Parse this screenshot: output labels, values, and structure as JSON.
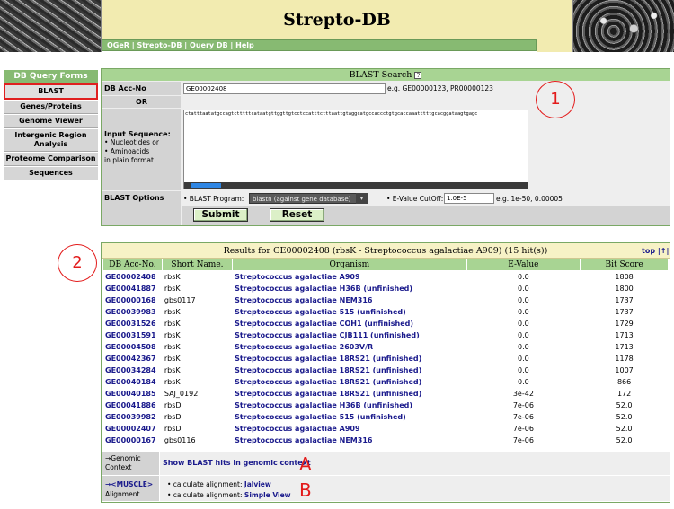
{
  "header": {
    "title": "Strepto-DB",
    "nav": [
      "OGeR",
      "Strepto-DB",
      "Query DB",
      "Help"
    ],
    "nav_sep": " | "
  },
  "menu": {
    "heading": "DB Query Forms",
    "items": [
      {
        "label": "BLAST",
        "active": true
      },
      {
        "label": "Genes/Proteins",
        "active": false
      },
      {
        "label": "Genome Viewer",
        "active": false
      },
      {
        "label": "Intergenic Region Analysis",
        "active": false
      },
      {
        "label": "Proteome Comparison",
        "active": false
      },
      {
        "label": "Sequences",
        "active": false
      }
    ]
  },
  "blast": {
    "title": "BLAST Search",
    "help_icon": "?",
    "acc_label": "DB Acc-No",
    "acc_value": "GE00002408",
    "acc_example": "e.g. GE00000123, PR00000123",
    "or_label": "OR",
    "seq_label": "Input Sequence:",
    "seq_hint_1": "• Nucleotides or",
    "seq_hint_2": "• Aminoacids",
    "seq_hint_3": "in plain format",
    "seq_value": "ctatttaatatgccagtctttttcataatgttggttgtcctccatttctttaattgtaggcatgccaccctgtgcaccaaatttttgcacggataagtgagc",
    "options_label": "BLAST Options",
    "program_label": "• BLAST Program:",
    "program_value": "blastn (against gene database)",
    "evalue_label": "• E-Value CutOff:",
    "evalue_value": "1.0E-5",
    "evalue_example": "e.g. 1e-50, 0.00005",
    "submit_label": "Submit",
    "reset_label": "Reset"
  },
  "annotations": {
    "c1": "1",
    "c2": "2",
    "a": "A",
    "b": "B"
  },
  "results": {
    "title": "Results for GE00002408 (rbsK - Streptococcus agalactiae A909) (15 hit(s))",
    "top_link": "top |↑|",
    "columns": [
      "DB Acc-No.",
      "Short Name.",
      "Organism",
      "E-Value",
      "Bit Score"
    ],
    "rows": [
      [
        "GE00002408",
        "rbsK",
        "Streptococcus agalactiae A909",
        "0.0",
        "1808"
      ],
      [
        "GE00041887",
        "rbsK",
        "Streptococcus agalactiae H36B (unfinished)",
        "0.0",
        "1800"
      ],
      [
        "GE00000168",
        "gbs0117",
        "Streptococcus agalactiae NEM316",
        "0.0",
        "1737"
      ],
      [
        "GE00039983",
        "rbsK",
        "Streptococcus agalactiae 515 (unfinished)",
        "0.0",
        "1737"
      ],
      [
        "GE00031526",
        "rbsK",
        "Streptococcus agalactiae COH1 (unfinished)",
        "0.0",
        "1729"
      ],
      [
        "GE00031591",
        "rbsK",
        "Streptococcus agalactiae CJB111 (unfinished)",
        "0.0",
        "1713"
      ],
      [
        "GE00004508",
        "rbsK",
        "Streptococcus agalactiae 2603V/R",
        "0.0",
        "1713"
      ],
      [
        "GE00042367",
        "rbsK",
        "Streptococcus agalactiae 18RS21 (unfinished)",
        "0.0",
        "1178"
      ],
      [
        "GE00034284",
        "rbsK",
        "Streptococcus agalactiae 18RS21 (unfinished)",
        "0.0",
        "1007"
      ],
      [
        "GE00040184",
        "rbsK",
        "Streptococcus agalactiae 18RS21 (unfinished)",
        "0.0",
        "866"
      ],
      [
        "GE00040185",
        "SAJ_0192",
        "Streptococcus agalactiae 18RS21 (unfinished)",
        "3e-42",
        "172"
      ],
      [
        "GE00041886",
        "rbsD",
        "Streptococcus agalactiae H36B (unfinished)",
        "7e-06",
        "52.0"
      ],
      [
        "GE00039982",
        "rbsD",
        "Streptococcus agalactiae 515 (unfinished)",
        "7e-06",
        "52.0"
      ],
      [
        "GE00002407",
        "rbsD",
        "Streptococcus agalactiae A909",
        "7e-06",
        "52.0"
      ],
      [
        "GE00000167",
        "gbs0116",
        "Streptococcus agalactiae NEM316",
        "7e-06",
        "52.0"
      ]
    ],
    "context_label_1": "→Genomic",
    "context_label_2": "Context",
    "context_link": "Show BLAST hits in genomic context",
    "align_label_link": "→<MUSCLE>",
    "align_label_2": "Alignment",
    "align_1_text": "• calculate alignment:",
    "align_1_link": "Jalview",
    "align_2_text": "• calculate alignment:",
    "align_2_link": "Simple View"
  },
  "colors": {
    "accent_green": "#87ba72",
    "header_yellow": "#f2ebb0",
    "link_blue": "#1a1a8c",
    "annotation_red": "#e31b1b"
  }
}
